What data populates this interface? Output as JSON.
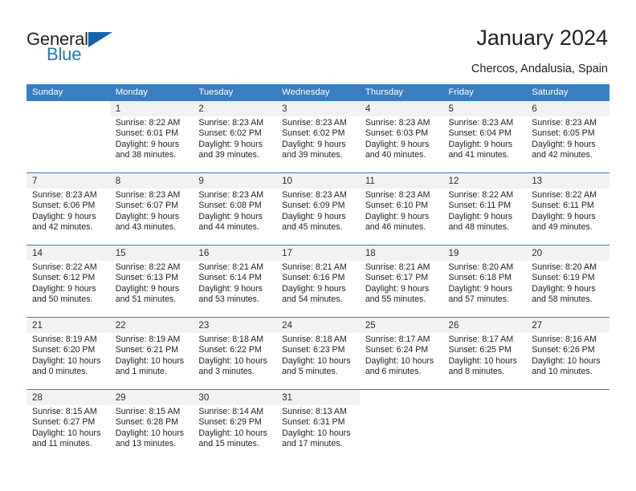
{
  "brand": {
    "name_part1": "General",
    "name_part2": "Blue",
    "accent_color": "#1565ad",
    "text_color": "#231f20"
  },
  "header": {
    "title": "January 2024",
    "location": "Chercos, Andalusia, Spain"
  },
  "calendar": {
    "header_bg": "#3b7ebf",
    "daynum_bg": "#f2f2f2",
    "weekdays": [
      "Sunday",
      "Monday",
      "Tuesday",
      "Wednesday",
      "Thursday",
      "Friday",
      "Saturday"
    ],
    "weeks": [
      [
        {
          "day": "",
          "sunrise": "",
          "sunset": "",
          "daylight1": "",
          "daylight2": ""
        },
        {
          "day": "1",
          "sunrise": "Sunrise: 8:22 AM",
          "sunset": "Sunset: 6:01 PM",
          "daylight1": "Daylight: 9 hours",
          "daylight2": "and 38 minutes."
        },
        {
          "day": "2",
          "sunrise": "Sunrise: 8:23 AM",
          "sunset": "Sunset: 6:02 PM",
          "daylight1": "Daylight: 9 hours",
          "daylight2": "and 39 minutes."
        },
        {
          "day": "3",
          "sunrise": "Sunrise: 8:23 AM",
          "sunset": "Sunset: 6:02 PM",
          "daylight1": "Daylight: 9 hours",
          "daylight2": "and 39 minutes."
        },
        {
          "day": "4",
          "sunrise": "Sunrise: 8:23 AM",
          "sunset": "Sunset: 6:03 PM",
          "daylight1": "Daylight: 9 hours",
          "daylight2": "and 40 minutes."
        },
        {
          "day": "5",
          "sunrise": "Sunrise: 8:23 AM",
          "sunset": "Sunset: 6:04 PM",
          "daylight1": "Daylight: 9 hours",
          "daylight2": "and 41 minutes."
        },
        {
          "day": "6",
          "sunrise": "Sunrise: 8:23 AM",
          "sunset": "Sunset: 6:05 PM",
          "daylight1": "Daylight: 9 hours",
          "daylight2": "and 42 minutes."
        }
      ],
      [
        {
          "day": "7",
          "sunrise": "Sunrise: 8:23 AM",
          "sunset": "Sunset: 6:06 PM",
          "daylight1": "Daylight: 9 hours",
          "daylight2": "and 42 minutes."
        },
        {
          "day": "8",
          "sunrise": "Sunrise: 8:23 AM",
          "sunset": "Sunset: 6:07 PM",
          "daylight1": "Daylight: 9 hours",
          "daylight2": "and 43 minutes."
        },
        {
          "day": "9",
          "sunrise": "Sunrise: 8:23 AM",
          "sunset": "Sunset: 6:08 PM",
          "daylight1": "Daylight: 9 hours",
          "daylight2": "and 44 minutes."
        },
        {
          "day": "10",
          "sunrise": "Sunrise: 8:23 AM",
          "sunset": "Sunset: 6:09 PM",
          "daylight1": "Daylight: 9 hours",
          "daylight2": "and 45 minutes."
        },
        {
          "day": "11",
          "sunrise": "Sunrise: 8:23 AM",
          "sunset": "Sunset: 6:10 PM",
          "daylight1": "Daylight: 9 hours",
          "daylight2": "and 46 minutes."
        },
        {
          "day": "12",
          "sunrise": "Sunrise: 8:22 AM",
          "sunset": "Sunset: 6:11 PM",
          "daylight1": "Daylight: 9 hours",
          "daylight2": "and 48 minutes."
        },
        {
          "day": "13",
          "sunrise": "Sunrise: 8:22 AM",
          "sunset": "Sunset: 6:11 PM",
          "daylight1": "Daylight: 9 hours",
          "daylight2": "and 49 minutes."
        }
      ],
      [
        {
          "day": "14",
          "sunrise": "Sunrise: 8:22 AM",
          "sunset": "Sunset: 6:12 PM",
          "daylight1": "Daylight: 9 hours",
          "daylight2": "and 50 minutes."
        },
        {
          "day": "15",
          "sunrise": "Sunrise: 8:22 AM",
          "sunset": "Sunset: 6:13 PM",
          "daylight1": "Daylight: 9 hours",
          "daylight2": "and 51 minutes."
        },
        {
          "day": "16",
          "sunrise": "Sunrise: 8:21 AM",
          "sunset": "Sunset: 6:14 PM",
          "daylight1": "Daylight: 9 hours",
          "daylight2": "and 53 minutes."
        },
        {
          "day": "17",
          "sunrise": "Sunrise: 8:21 AM",
          "sunset": "Sunset: 6:16 PM",
          "daylight1": "Daylight: 9 hours",
          "daylight2": "and 54 minutes."
        },
        {
          "day": "18",
          "sunrise": "Sunrise: 8:21 AM",
          "sunset": "Sunset: 6:17 PM",
          "daylight1": "Daylight: 9 hours",
          "daylight2": "and 55 minutes."
        },
        {
          "day": "19",
          "sunrise": "Sunrise: 8:20 AM",
          "sunset": "Sunset: 6:18 PM",
          "daylight1": "Daylight: 9 hours",
          "daylight2": "and 57 minutes."
        },
        {
          "day": "20",
          "sunrise": "Sunrise: 8:20 AM",
          "sunset": "Sunset: 6:19 PM",
          "daylight1": "Daylight: 9 hours",
          "daylight2": "and 58 minutes."
        }
      ],
      [
        {
          "day": "21",
          "sunrise": "Sunrise: 8:19 AM",
          "sunset": "Sunset: 6:20 PM",
          "daylight1": "Daylight: 10 hours",
          "daylight2": "and 0 minutes."
        },
        {
          "day": "22",
          "sunrise": "Sunrise: 8:19 AM",
          "sunset": "Sunset: 6:21 PM",
          "daylight1": "Daylight: 10 hours",
          "daylight2": "and 1 minute."
        },
        {
          "day": "23",
          "sunrise": "Sunrise: 8:18 AM",
          "sunset": "Sunset: 6:22 PM",
          "daylight1": "Daylight: 10 hours",
          "daylight2": "and 3 minutes."
        },
        {
          "day": "24",
          "sunrise": "Sunrise: 8:18 AM",
          "sunset": "Sunset: 6:23 PM",
          "daylight1": "Daylight: 10 hours",
          "daylight2": "and 5 minutes."
        },
        {
          "day": "25",
          "sunrise": "Sunrise: 8:17 AM",
          "sunset": "Sunset: 6:24 PM",
          "daylight1": "Daylight: 10 hours",
          "daylight2": "and 6 minutes."
        },
        {
          "day": "26",
          "sunrise": "Sunrise: 8:17 AM",
          "sunset": "Sunset: 6:25 PM",
          "daylight1": "Daylight: 10 hours",
          "daylight2": "and 8 minutes."
        },
        {
          "day": "27",
          "sunrise": "Sunrise: 8:16 AM",
          "sunset": "Sunset: 6:26 PM",
          "daylight1": "Daylight: 10 hours",
          "daylight2": "and 10 minutes."
        }
      ],
      [
        {
          "day": "28",
          "sunrise": "Sunrise: 8:15 AM",
          "sunset": "Sunset: 6:27 PM",
          "daylight1": "Daylight: 10 hours",
          "daylight2": "and 11 minutes."
        },
        {
          "day": "29",
          "sunrise": "Sunrise: 8:15 AM",
          "sunset": "Sunset: 6:28 PM",
          "daylight1": "Daylight: 10 hours",
          "daylight2": "and 13 minutes."
        },
        {
          "day": "30",
          "sunrise": "Sunrise: 8:14 AM",
          "sunset": "Sunset: 6:29 PM",
          "daylight1": "Daylight: 10 hours",
          "daylight2": "and 15 minutes."
        },
        {
          "day": "31",
          "sunrise": "Sunrise: 8:13 AM",
          "sunset": "Sunset: 6:31 PM",
          "daylight1": "Daylight: 10 hours",
          "daylight2": "and 17 minutes."
        },
        {
          "day": "",
          "sunrise": "",
          "sunset": "",
          "daylight1": "",
          "daylight2": ""
        },
        {
          "day": "",
          "sunrise": "",
          "sunset": "",
          "daylight1": "",
          "daylight2": ""
        },
        {
          "day": "",
          "sunrise": "",
          "sunset": "",
          "daylight1": "",
          "daylight2": ""
        }
      ]
    ]
  }
}
